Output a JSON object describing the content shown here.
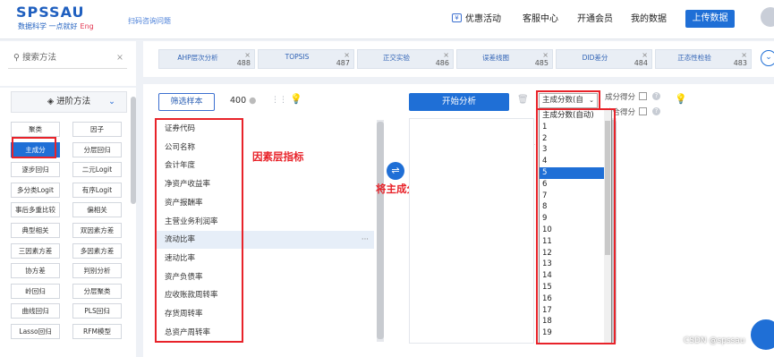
{
  "brand": {
    "logo": "SPSSAU",
    "subtitle": "数据科学 一点就好",
    "eng": "Eng",
    "scan": "扫码咨询问题"
  },
  "nav": {
    "promo": "优惠活动",
    "service": "客服中心",
    "vip": "开通会员",
    "mydata": "我的数据",
    "upload": "上传数据"
  },
  "sidebar": {
    "search_placeholder": "搜索方法",
    "search_clear": "×",
    "advanced_label": "进阶方法",
    "methods": [
      {
        "label": "聚类"
      },
      {
        "label": "因子"
      },
      {
        "label": "主成分"
      },
      {
        "label": "分层回归"
      },
      {
        "label": "逐步回归"
      },
      {
        "label": "二元Logit"
      },
      {
        "label": "多分类Logit"
      },
      {
        "label": "有序Logit"
      },
      {
        "label": "事后多重比较"
      },
      {
        "label": "偏相关"
      },
      {
        "label": "典型相关"
      },
      {
        "label": "双因素方差"
      },
      {
        "label": "三因素方差"
      },
      {
        "label": "多因素方差"
      },
      {
        "label": "协方差"
      },
      {
        "label": "判别分析"
      },
      {
        "label": "岭回归"
      },
      {
        "label": "分层聚类"
      },
      {
        "label": "曲线回归"
      },
      {
        "label": "PLS回归"
      },
      {
        "label": "Lasso回归"
      },
      {
        "label": "RFM模型"
      }
    ],
    "selected_index": 2
  },
  "tags": [
    {
      "label": "AHP层次分析",
      "count": "488"
    },
    {
      "label": "TOPSIS",
      "count": "487"
    },
    {
      "label": "正交实验",
      "count": "486"
    },
    {
      "label": "误差线图",
      "count": "485"
    },
    {
      "label": "DID差分",
      "count": "484"
    },
    {
      "label": "正态性检验",
      "count": "483"
    }
  ],
  "toolbar": {
    "filter": "筛选样本",
    "count": "400",
    "start": "开始分析"
  },
  "variables": [
    "证券代码",
    "公司名称",
    "会计年度",
    "净资产收益率",
    "资产报酬率",
    "主营业务利润率",
    "流动比率",
    "速动比率",
    "资产负债率",
    "应收账款周转率",
    "存货周转率",
    "总资产周转率"
  ],
  "variables_highlight_index": 6,
  "annotations": {
    "factor_layer": "因素层指标",
    "instruction": "将主成分数设置为准则层个数"
  },
  "select": {
    "value": "主成分数(自",
    "arrow": "⌄"
  },
  "checks": [
    {
      "label": "成分得分"
    },
    {
      "label": "综合得分"
    }
  ],
  "dropdown": {
    "options": [
      "主成分数(自动)",
      "1",
      "2",
      "3",
      "4",
      "5",
      "6",
      "7",
      "8",
      "9",
      "10",
      "11",
      "12",
      "13",
      "14",
      "15",
      "16",
      "17",
      "18",
      "19"
    ],
    "selected_index": 5
  },
  "watermark": "CSDN @spssau",
  "colors": {
    "brand": "#1f6fd6",
    "annotation": "#e8232a"
  }
}
